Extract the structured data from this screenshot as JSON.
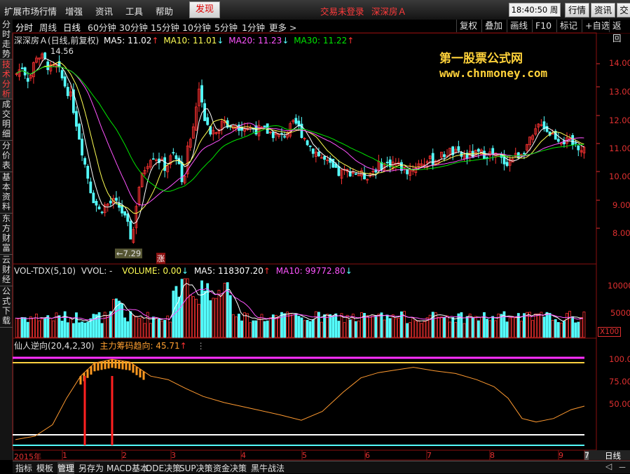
{
  "menubar": {
    "items": [
      "扩展市场行情",
      "增强",
      "资讯",
      "工具",
      "帮助"
    ],
    "discover": "发现",
    "login_status": "交易未登录",
    "stock_name": "深深房Ａ",
    "clock": "18:40:50 周三",
    "right_buttons": [
      "行情",
      "资讯",
      "交"
    ]
  },
  "toolbar": {
    "periods": [
      "分时",
      "周线",
      "日线",
      "60分钟",
      "30分钟",
      "15分钟",
      "10分钟",
      "5分钟",
      "1分钟",
      "更多 >"
    ],
    "right": [
      "复权",
      "叠加",
      "画线",
      "F10",
      "标记",
      "+自选",
      "返回"
    ]
  },
  "sidebar": {
    "tabs": [
      "分时走势",
      "技术分析",
      "成交明细",
      "分价表",
      "基本资料",
      "东方财富",
      "云财经",
      "公式下载"
    ]
  },
  "price_panel": {
    "title": "深深房Ａ(日线,前复权)",
    "ma5": "MA5: 11.02",
    "ma10": "MA10: 11.01",
    "ma20": "MA20: 11.23",
    "ma30": "MA30: 11.22",
    "high_label": "14.56",
    "low_label": "7.29",
    "zhang": "涨",
    "y_ticks": [
      "14.00",
      "13.00",
      "12.00",
      "11.00",
      "10.00",
      "9.00",
      "8.00"
    ]
  },
  "volume_panel": {
    "title": "VOL-TDX(5,10)",
    "vvol": "VVOL: -",
    "volume": "VOLUME: 0.00",
    "ma5": "MA5: 118307.20",
    "ma10": "MA10: 99772.80",
    "y_ticks": [
      "10000",
      "5000"
    ],
    "unit": "X100"
  },
  "indicator_panel": {
    "title": "仙人逆向(20,4,2,30)",
    "value": "主力筹码趋向: 45.71",
    "y_ticks": [
      "100.0",
      "75.00",
      "50.00"
    ]
  },
  "date_axis": [
    "2015年",
    "1",
    "2",
    "3",
    "4",
    "5",
    "6",
    "7",
    "8",
    "9",
    "7"
  ],
  "period_label": "日线",
  "watermark": {
    "line1": "第一股票公式网",
    "line2": "www.chnmoney.com"
  },
  "bottom_tabs": [
    "指标",
    "模板",
    "管理",
    "另存为",
    "MACD基本",
    "DDE决策",
    "SUP决策",
    "资金决策",
    "黑牛战法"
  ],
  "colors": {
    "up": "#ff3232",
    "down": "#54fcfc",
    "ma5": "#ffffff",
    "ma10": "#ffff54",
    "ma20": "#ff54ff",
    "ma30": "#00e600",
    "accent": "#ff3b3b"
  }
}
